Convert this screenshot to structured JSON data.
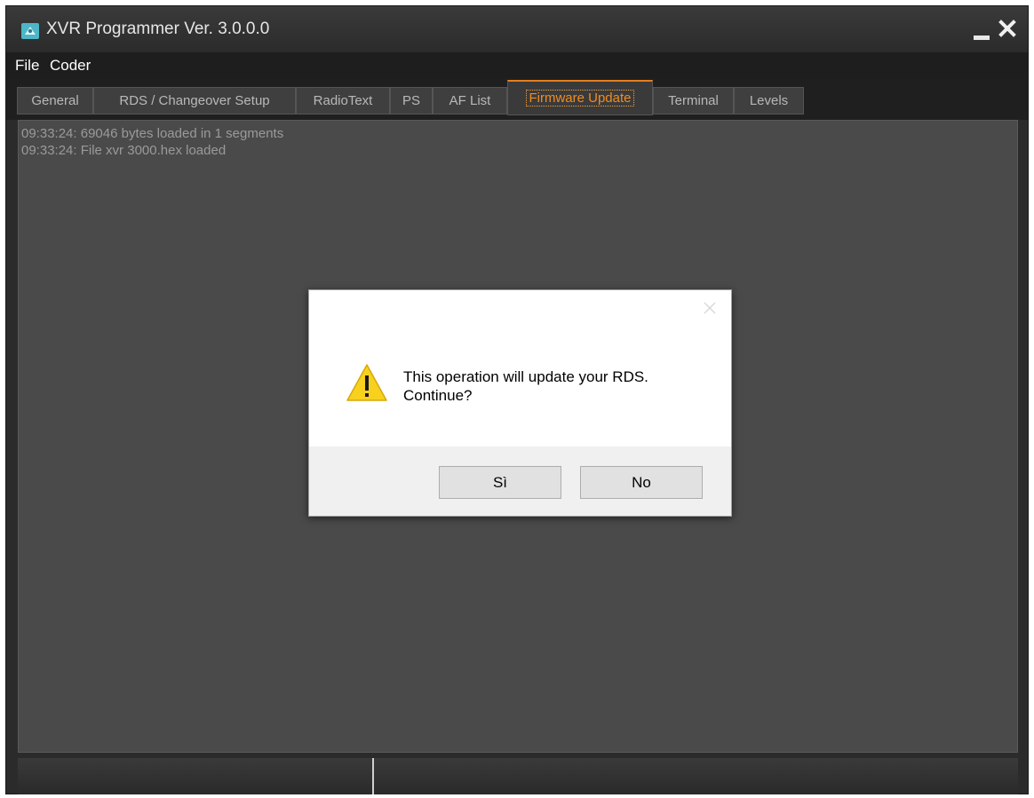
{
  "window": {
    "title": "XVR Programmer  Ver. 3.0.0.0",
    "app_icon": "app-logo-icon",
    "controls": [
      "minimize-icon",
      "close-icon"
    ]
  },
  "menu": {
    "items": [
      {
        "label": "File"
      },
      {
        "label": "Coder"
      }
    ]
  },
  "tabs": [
    {
      "label": "General"
    },
    {
      "label": "RDS / Changeover Setup"
    },
    {
      "label": "RadioText"
    },
    {
      "label": "PS"
    },
    {
      "label": "AF List"
    },
    {
      "label": "Firmware Update",
      "active": true
    },
    {
      "label": "Terminal"
    },
    {
      "label": "Levels"
    }
  ],
  "log": {
    "lines": [
      "09:33:24: 69046 bytes loaded in 1 segments",
      "09:33:24: File xvr 3000.hex loaded"
    ]
  },
  "dialog": {
    "icon": "warning-icon",
    "message_line1": "This operation will update your RDS.",
    "message_line2": "Continue?",
    "yes_label": "Sì",
    "no_label": "No"
  },
  "colors": {
    "accent": "#e47e1e",
    "active_tab_text": "#f28c1f",
    "content_bg": "#4a4a4a",
    "chrome_bg": "#2b2b2b"
  }
}
